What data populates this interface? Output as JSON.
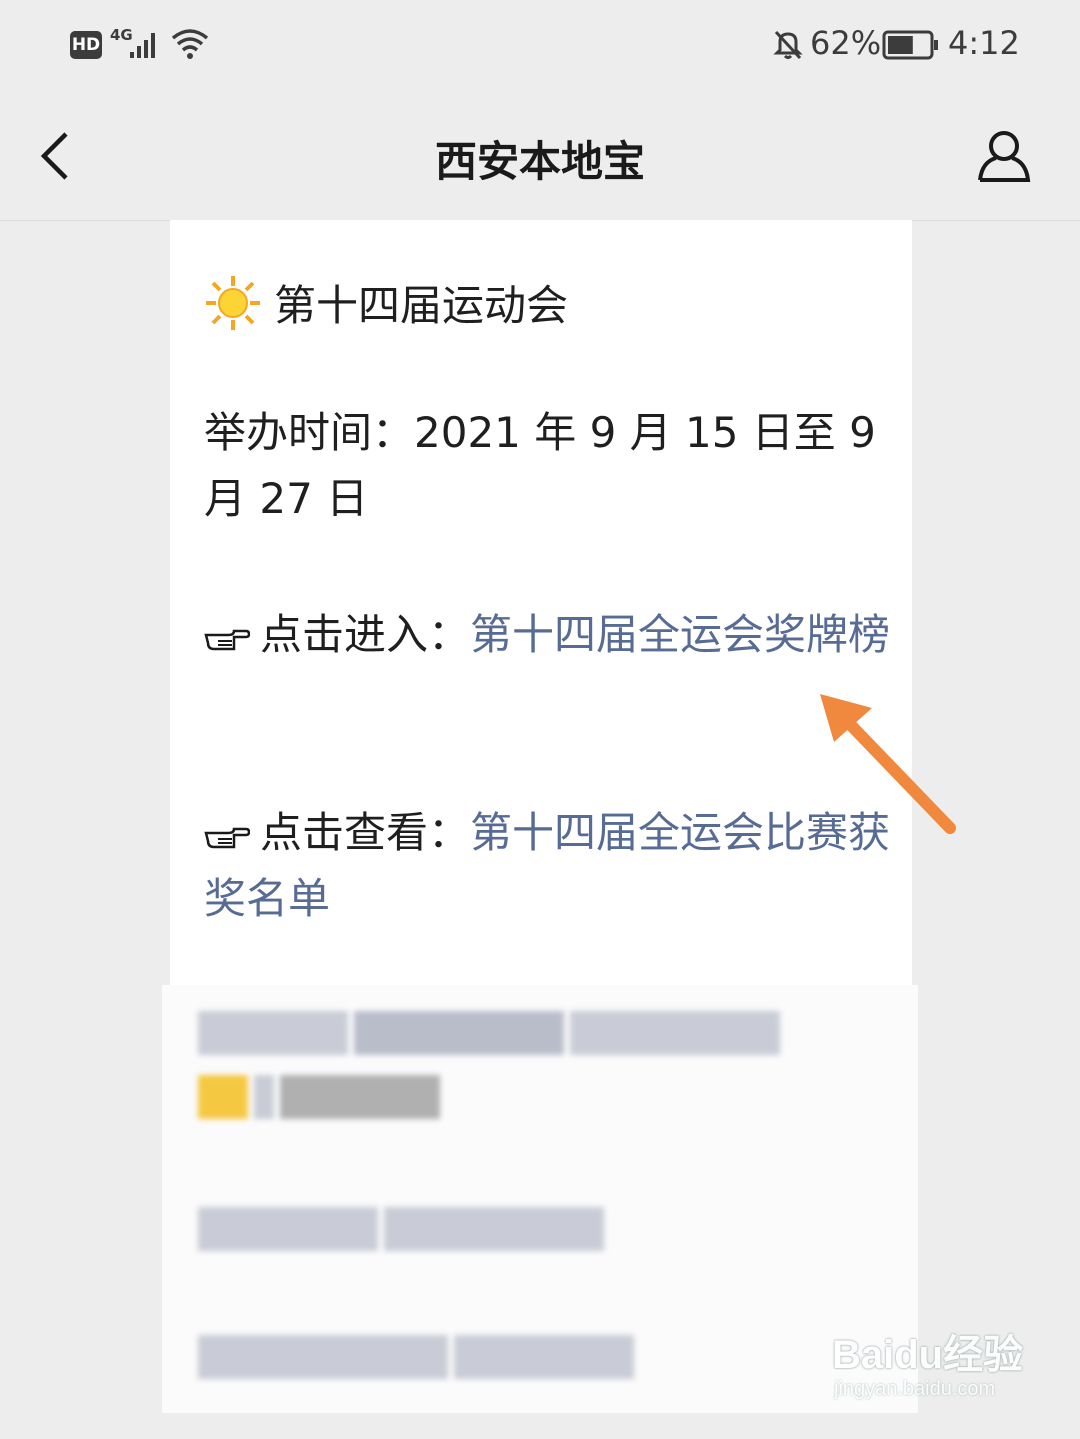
{
  "status_bar": {
    "hd": "HD",
    "network": "4G",
    "battery_percent": "62%",
    "time": "4:12",
    "battery_level": 0.62
  },
  "nav": {
    "title": "西安本地宝"
  },
  "article": {
    "heading": "第十四届运动会",
    "date_line": "举办时间：2021 年 9 月 15 日至 9 月 27 日",
    "link1_prefix": "点击进入：",
    "link1_text": "第十四届全运会奖牌榜",
    "link2_prefix": "点击查看：",
    "link2_text": "第十四届全运会比赛获奖名单"
  },
  "icons": {
    "sun": "sun-icon",
    "pointing_hand": "pointing-hand-icon",
    "back": "chevron-left-icon",
    "profile": "user-icon"
  },
  "colors": {
    "link": "#576b95",
    "arrow": "#f0883e",
    "background": "#ededed"
  },
  "watermark": {
    "main": "Baidu经验",
    "sub": "jingyan.baidu.com"
  }
}
